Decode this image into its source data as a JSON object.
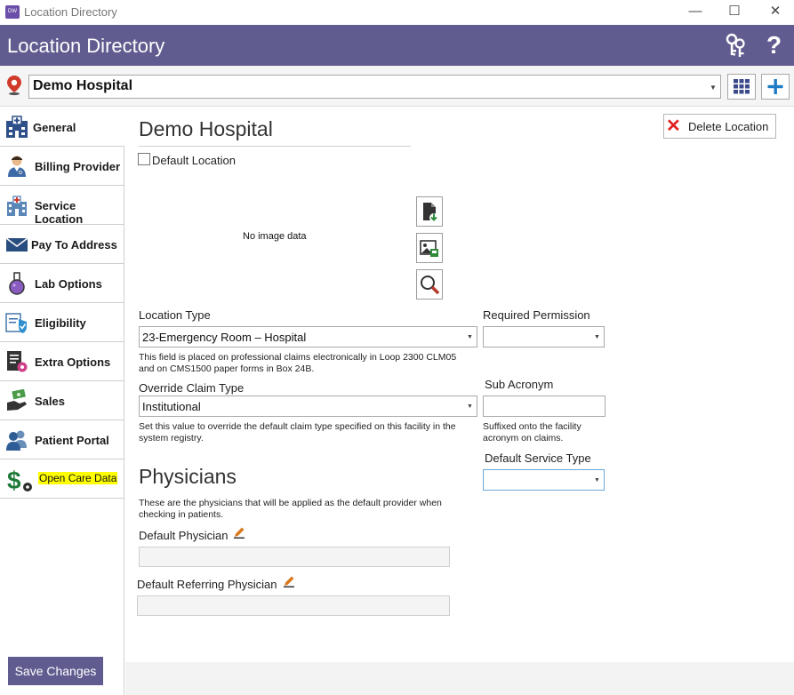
{
  "window": {
    "app_icon_text": "DW",
    "title": "Location Directory",
    "minimize_glyph": "—",
    "maximize_glyph": "☐",
    "close_glyph": "✕"
  },
  "header": {
    "title": "Location Directory",
    "help_glyph": "?",
    "icons": [
      "keys-icon",
      "help-icon"
    ],
    "accent_color": "#605c8f"
  },
  "location_bar": {
    "selected_location": "Demo Hospital",
    "icons": [
      "map-pin-icon",
      "grid-icon",
      "plus-icon"
    ]
  },
  "sidebar": {
    "items": [
      {
        "label": "General",
        "icon": "hospital-icon",
        "active": true
      },
      {
        "label": "Billing Provider",
        "icon": "doctor-icon"
      },
      {
        "label": "Service Location",
        "icon": "building-icon"
      },
      {
        "label": "Pay To Address",
        "icon": "envelope-icon"
      },
      {
        "label": "Lab Options",
        "icon": "flask-icon"
      },
      {
        "label": "Eligibility",
        "icon": "shield-check-icon"
      },
      {
        "label": "Extra Options",
        "icon": "document-gear-icon"
      },
      {
        "label": "Sales",
        "icon": "money-hand-icon"
      },
      {
        "label": "Patient Portal",
        "icon": "users-icon"
      },
      {
        "label": "Open Care Data",
        "icon": "dollar-gear-icon",
        "highlight": "#ffff00"
      }
    ],
    "save_label": "Save Changes"
  },
  "main": {
    "title": "Demo Hospital",
    "delete_label": "Delete Location",
    "delete_glyph": "✕",
    "default_location_label": "Default Location",
    "no_image_text": "No image data",
    "image_buttons": [
      "document-download-icon",
      "image-save-icon",
      "magnifier-icon"
    ],
    "location_type": {
      "label": "Location Type",
      "value": "23-Emergency Room – Hospital",
      "note": "This field is placed on professional claims electronically in Loop 2300 CLM05 and on CMS1500 paper forms in Box 24B."
    },
    "required_permission": {
      "label": "Required Permission",
      "value": ""
    },
    "override_claim_type": {
      "label": "Override Claim Type",
      "value": "Institutional",
      "note": "Set this value to override the default claim type specified on this facility in the system registry."
    },
    "sub_acronym": {
      "label": "Sub Acronym",
      "value": "",
      "note": "Suffixed onto the facility acronym on claims."
    },
    "default_service_type": {
      "label": "Default Service Type",
      "value": ""
    },
    "physicians": {
      "heading": "Physicians",
      "note": "These are the physicians that will be applied as the default provider when checking in patients.",
      "default_physician_label": "Default Physician",
      "default_physician_value": "",
      "default_referring_label": "Default Referring Physician",
      "default_referring_value": ""
    }
  }
}
